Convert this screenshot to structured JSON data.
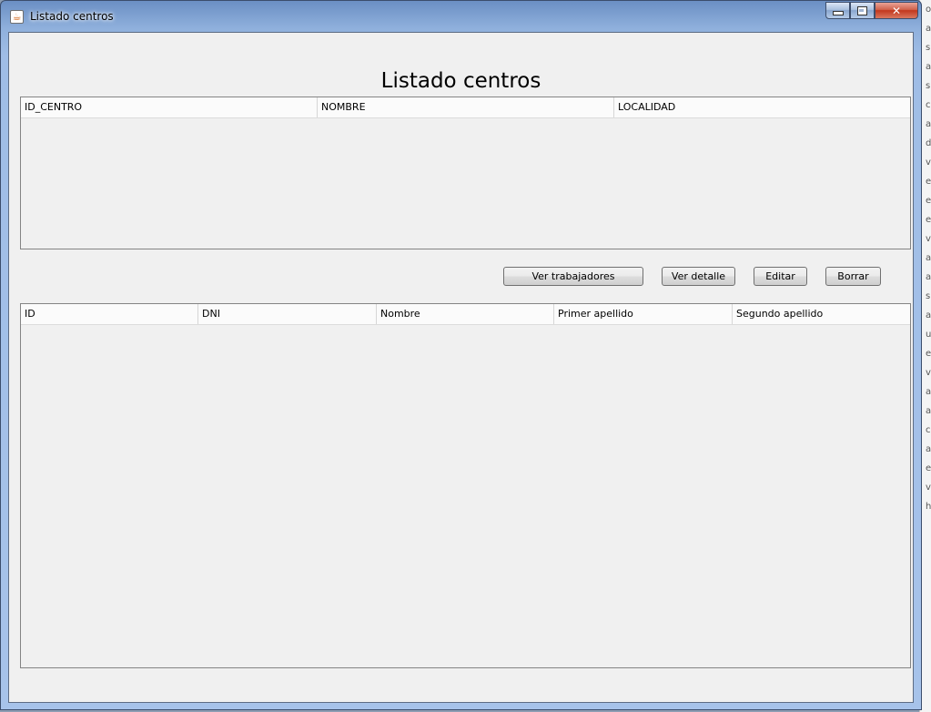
{
  "window": {
    "title": "Listado centros"
  },
  "heading": "Listado centros",
  "centros_table": {
    "columns": [
      "ID_CENTRO",
      "NOMBRE",
      "LOCALIDAD"
    ],
    "rows": []
  },
  "actions": {
    "ver_trabajadores": "Ver trabajadores",
    "ver_detalle": "Ver detalle",
    "editar": "Editar",
    "borrar": "Borrar"
  },
  "trabajadores_table": {
    "columns": [
      "ID",
      "DNI",
      "Nombre",
      "Primer apellido",
      "Segundo apellido"
    ],
    "rows": []
  },
  "background_strip": {
    "letters": [
      "o",
      "a",
      "s",
      "a",
      "s",
      "c",
      "a",
      "d",
      "v",
      "e",
      "e",
      "e",
      "v",
      "a",
      "a",
      "s",
      "a",
      "u",
      "e",
      "v",
      "a",
      "a",
      "c",
      "a",
      "e",
      "v",
      "h"
    ]
  },
  "colors": {
    "client_bg": "#f0f0f0",
    "title_gradient_top": "#6b8fc4",
    "close_button": "#c2361c"
  }
}
